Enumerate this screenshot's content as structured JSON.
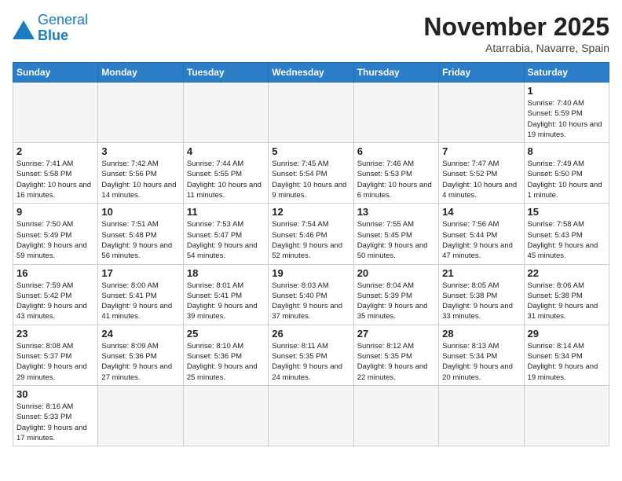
{
  "header": {
    "logo_line1": "General",
    "logo_line2": "Blue",
    "month": "November 2025",
    "location": "Atarrabia, Navarre, Spain"
  },
  "weekdays": [
    "Sunday",
    "Monday",
    "Tuesday",
    "Wednesday",
    "Thursday",
    "Friday",
    "Saturday"
  ],
  "days": [
    {
      "num": "",
      "info": ""
    },
    {
      "num": "",
      "info": ""
    },
    {
      "num": "",
      "info": ""
    },
    {
      "num": "",
      "info": ""
    },
    {
      "num": "",
      "info": ""
    },
    {
      "num": "",
      "info": ""
    },
    {
      "num": "1",
      "info": "Sunrise: 7:40 AM\nSunset: 5:59 PM\nDaylight: 10 hours and 19 minutes."
    },
    {
      "num": "2",
      "info": "Sunrise: 7:41 AM\nSunset: 5:58 PM\nDaylight: 10 hours and 16 minutes."
    },
    {
      "num": "3",
      "info": "Sunrise: 7:42 AM\nSunset: 5:56 PM\nDaylight: 10 hours and 14 minutes."
    },
    {
      "num": "4",
      "info": "Sunrise: 7:44 AM\nSunset: 5:55 PM\nDaylight: 10 hours and 11 minutes."
    },
    {
      "num": "5",
      "info": "Sunrise: 7:45 AM\nSunset: 5:54 PM\nDaylight: 10 hours and 9 minutes."
    },
    {
      "num": "6",
      "info": "Sunrise: 7:46 AM\nSunset: 5:53 PM\nDaylight: 10 hours and 6 minutes."
    },
    {
      "num": "7",
      "info": "Sunrise: 7:47 AM\nSunset: 5:52 PM\nDaylight: 10 hours and 4 minutes."
    },
    {
      "num": "8",
      "info": "Sunrise: 7:49 AM\nSunset: 5:50 PM\nDaylight: 10 hours and 1 minute."
    },
    {
      "num": "9",
      "info": "Sunrise: 7:50 AM\nSunset: 5:49 PM\nDaylight: 9 hours and 59 minutes."
    },
    {
      "num": "10",
      "info": "Sunrise: 7:51 AM\nSunset: 5:48 PM\nDaylight: 9 hours and 56 minutes."
    },
    {
      "num": "11",
      "info": "Sunrise: 7:53 AM\nSunset: 5:47 PM\nDaylight: 9 hours and 54 minutes."
    },
    {
      "num": "12",
      "info": "Sunrise: 7:54 AM\nSunset: 5:46 PM\nDaylight: 9 hours and 52 minutes."
    },
    {
      "num": "13",
      "info": "Sunrise: 7:55 AM\nSunset: 5:45 PM\nDaylight: 9 hours and 50 minutes."
    },
    {
      "num": "14",
      "info": "Sunrise: 7:56 AM\nSunset: 5:44 PM\nDaylight: 9 hours and 47 minutes."
    },
    {
      "num": "15",
      "info": "Sunrise: 7:58 AM\nSunset: 5:43 PM\nDaylight: 9 hours and 45 minutes."
    },
    {
      "num": "16",
      "info": "Sunrise: 7:59 AM\nSunset: 5:42 PM\nDaylight: 9 hours and 43 minutes."
    },
    {
      "num": "17",
      "info": "Sunrise: 8:00 AM\nSunset: 5:41 PM\nDaylight: 9 hours and 41 minutes."
    },
    {
      "num": "18",
      "info": "Sunrise: 8:01 AM\nSunset: 5:41 PM\nDaylight: 9 hours and 39 minutes."
    },
    {
      "num": "19",
      "info": "Sunrise: 8:03 AM\nSunset: 5:40 PM\nDaylight: 9 hours and 37 minutes."
    },
    {
      "num": "20",
      "info": "Sunrise: 8:04 AM\nSunset: 5:39 PM\nDaylight: 9 hours and 35 minutes."
    },
    {
      "num": "21",
      "info": "Sunrise: 8:05 AM\nSunset: 5:38 PM\nDaylight: 9 hours and 33 minutes."
    },
    {
      "num": "22",
      "info": "Sunrise: 8:06 AM\nSunset: 5:38 PM\nDaylight: 9 hours and 31 minutes."
    },
    {
      "num": "23",
      "info": "Sunrise: 8:08 AM\nSunset: 5:37 PM\nDaylight: 9 hours and 29 minutes."
    },
    {
      "num": "24",
      "info": "Sunrise: 8:09 AM\nSunset: 5:36 PM\nDaylight: 9 hours and 27 minutes."
    },
    {
      "num": "25",
      "info": "Sunrise: 8:10 AM\nSunset: 5:36 PM\nDaylight: 9 hours and 25 minutes."
    },
    {
      "num": "26",
      "info": "Sunrise: 8:11 AM\nSunset: 5:35 PM\nDaylight: 9 hours and 24 minutes."
    },
    {
      "num": "27",
      "info": "Sunrise: 8:12 AM\nSunset: 5:35 PM\nDaylight: 9 hours and 22 minutes."
    },
    {
      "num": "28",
      "info": "Sunrise: 8:13 AM\nSunset: 5:34 PM\nDaylight: 9 hours and 20 minutes."
    },
    {
      "num": "29",
      "info": "Sunrise: 8:14 AM\nSunset: 5:34 PM\nDaylight: 9 hours and 19 minutes."
    },
    {
      "num": "30",
      "info": "Sunrise: 8:16 AM\nSunset: 5:33 PM\nDaylight: 9 hours and 17 minutes."
    },
    {
      "num": "",
      "info": ""
    },
    {
      "num": "",
      "info": ""
    },
    {
      "num": "",
      "info": ""
    },
    {
      "num": "",
      "info": ""
    },
    {
      "num": "",
      "info": ""
    },
    {
      "num": "",
      "info": ""
    }
  ]
}
